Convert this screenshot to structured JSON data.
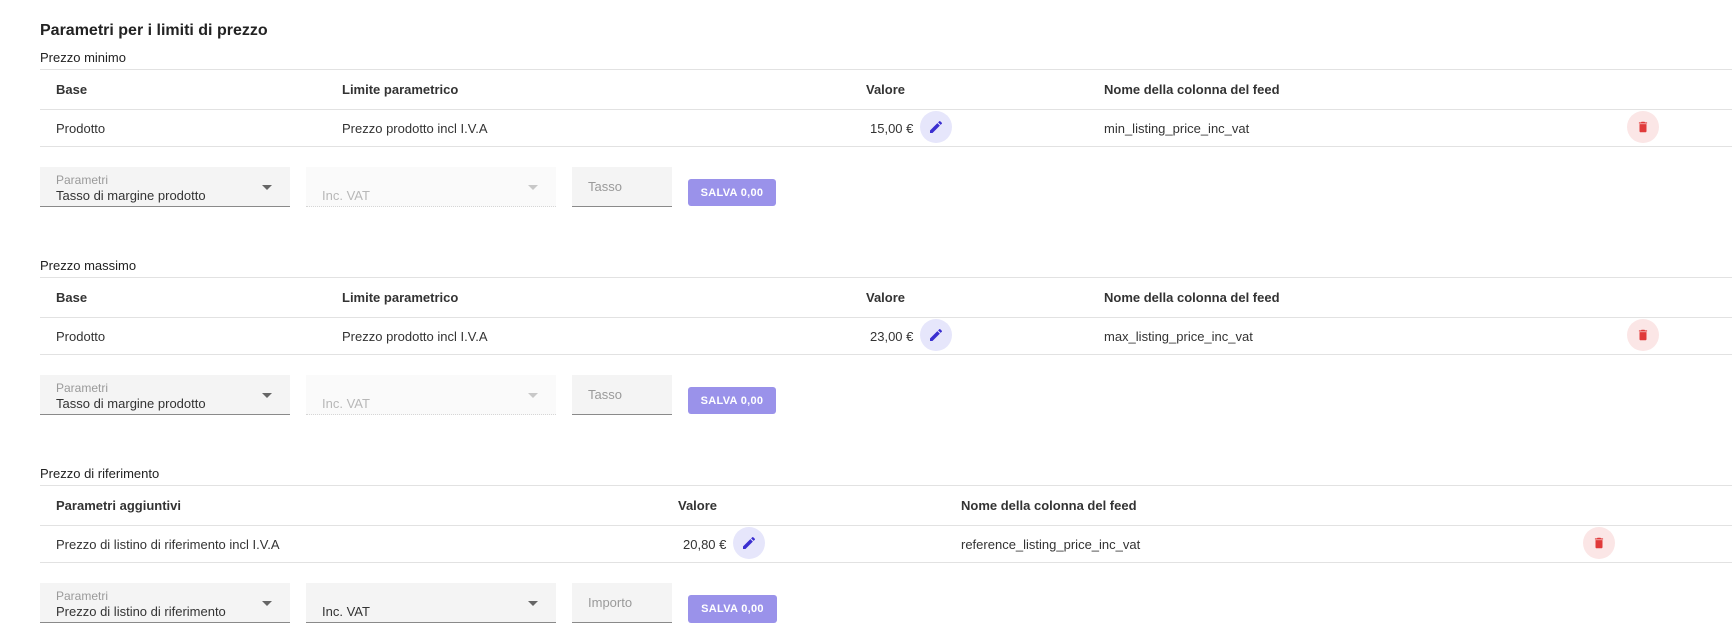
{
  "title": "Parametri per i limiti di prezzo",
  "colors": {
    "accent": "#9a92ea",
    "edit_bg": "#e6e6fb",
    "edit_icon": "#3b2fd0",
    "delete_bg": "#fbe6e6",
    "delete_icon": "#e03a3a"
  },
  "icons": {
    "edit": "pencil-icon",
    "delete": "trash-icon",
    "dropdown": "caret-down-icon"
  },
  "min_price": {
    "label": "Prezzo minimo",
    "headers": {
      "base": "Base",
      "limit": "Limite parametrico",
      "value": "Valore",
      "feed": "Nome della colonna del feed"
    },
    "row": {
      "base": "Prodotto",
      "limit": "Prezzo prodotto incl I.V.A",
      "value": "15,00 €",
      "feed": "min_listing_price_inc_vat"
    },
    "form": {
      "param_label": "Parametri",
      "param_value": "Tasso di margine prodotto",
      "vat_value": "Inc. VAT",
      "rate_placeholder": "Tasso",
      "save_label": "SALVA 0,00"
    }
  },
  "max_price": {
    "label": "Prezzo massimo",
    "headers": {
      "base": "Base",
      "limit": "Limite parametrico",
      "value": "Valore",
      "feed": "Nome della colonna del feed"
    },
    "row": {
      "base": "Prodotto",
      "limit": "Prezzo prodotto incl I.V.A",
      "value": "23,00 €",
      "feed": "max_listing_price_inc_vat"
    },
    "form": {
      "param_label": "Parametri",
      "param_value": "Tasso di margine prodotto",
      "vat_value": "Inc. VAT",
      "rate_placeholder": "Tasso",
      "save_label": "SALVA 0,00"
    }
  },
  "ref_price": {
    "label": "Prezzo di riferimento",
    "headers": {
      "params": "Parametri aggiuntivi",
      "value": "Valore",
      "feed": "Nome della colonna del feed"
    },
    "row": {
      "params": "Prezzo di listino di riferimento incl I.V.A",
      "value": "20,80 €",
      "feed": "reference_listing_price_inc_vat"
    },
    "form": {
      "param_label": "Parametri",
      "param_value": "Prezzo di listino di riferimento",
      "vat_value": "Inc. VAT",
      "amount_placeholder": "Importo",
      "save_label": "SALVA 0,00"
    }
  }
}
